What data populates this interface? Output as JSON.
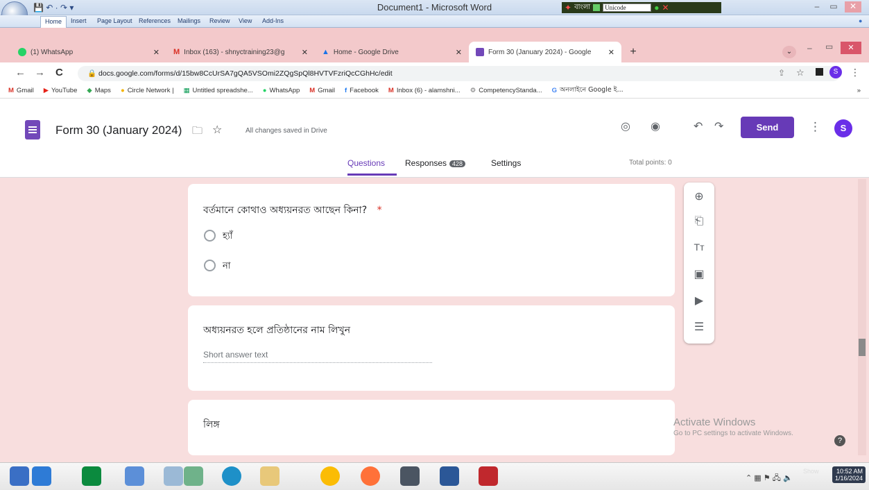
{
  "word": {
    "title": "Document1 - Microsoft Word",
    "ribbon_tabs": [
      "Home",
      "Insert",
      "Page Layout",
      "References",
      "Mailings",
      "Review",
      "View",
      "Add-Ins"
    ],
    "bijoy_label": "বাংলা",
    "font_select": "Unicode"
  },
  "browser": {
    "tabs": [
      {
        "label": "(1) WhatsApp",
        "favicon": "whatsapp-icon",
        "color": "#25d366"
      },
      {
        "label": "Inbox (163) - shnyctraining23@g",
        "favicon": "gmail-icon",
        "color": "#d93025"
      },
      {
        "label": "Home - Google Drive",
        "favicon": "drive-icon",
        "color": "#1a73e8"
      },
      {
        "label": "Form 30 (January 2024) - Google",
        "favicon": "forms-icon",
        "color": "#7248b9"
      }
    ],
    "url": "docs.google.com/forms/d/15bw8CcUrSA7gQA5VSOmi2ZQgSpQl8HVTVFzriQcCGhHc/edit",
    "bookmarks": [
      "Gmail",
      "YouTube",
      "Maps",
      "Circle Network |",
      "Untitled spreadshe...",
      "WhatsApp",
      "Gmail",
      "Facebook",
      "Inbox (6) - alamshni...",
      "CompetencyStanda...",
      "অনলাইনে Google ই..."
    ]
  },
  "form": {
    "title": "Form 30 (January 2024)",
    "saved_status": "All changes saved in Drive",
    "send_label": "Send",
    "avatar_letter": "S",
    "nav": {
      "questions": "Questions",
      "responses": "Responses",
      "responses_count": "428",
      "settings": "Settings"
    },
    "total_points": "Total points: 0",
    "questions": [
      {
        "title": "বর্তমানে কোথাও অধ্যয়নরত আছেন কিনা?",
        "required": "*",
        "options": [
          "হ্যাঁ",
          "না"
        ]
      },
      {
        "title": "অধ্যয়নরত হলে প্রতিষ্ঠানের নাম লিখুন",
        "placeholder": "Short answer text"
      },
      {
        "title": "লিঙ্গ"
      }
    ]
  },
  "watermark": {
    "line1": "Activate Windows",
    "line2": "Go to PC settings to activate Windows."
  },
  "taskbar": {
    "time": "10:52 AM",
    "date": "1/16/2024",
    "show_label": "Show"
  }
}
